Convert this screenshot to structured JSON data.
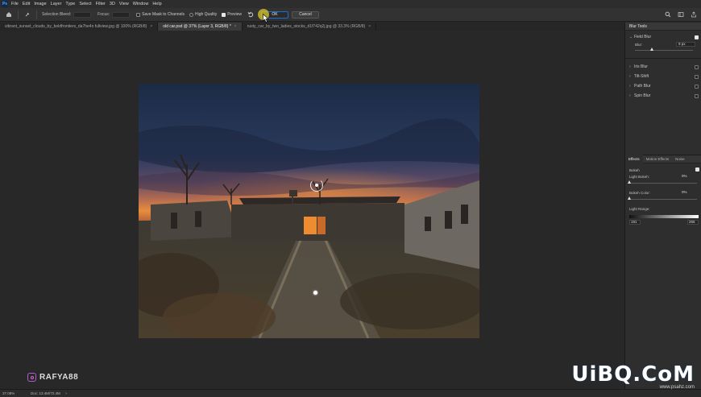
{
  "app": {
    "logo": "Ps",
    "menu": [
      "File",
      "Edit",
      "Image",
      "Layer",
      "Type",
      "Select",
      "Filter",
      "3D",
      "View",
      "Window",
      "Help"
    ]
  },
  "options": {
    "selection_bleed_label": "Selection Bleed:",
    "focus_label": "Focus:",
    "save_mask_label": "Save Mask to Channels",
    "high_quality_label": "High Quality",
    "preview_label": "Preview",
    "preview_checked": true,
    "ok_label": "OK",
    "cancel_label": "Cancel"
  },
  "tabs": [
    {
      "label": "vibrant_sunset_clouds_by_boldfrontiers_da7he4n fullview.jpg @ 100% (RGB/8)",
      "active": false
    },
    {
      "label": "old car.psd @ 37% (Layer 3, RGB/8) *",
      "active": true
    },
    {
      "label": "rusty_car_by_two_ladies_stocks_d1f742q2j.jpg @ 33.3% (RGB/8)",
      "active": false
    }
  ],
  "blur_tools": {
    "header": "Blur Tools",
    "items": [
      {
        "label": "Field Blur",
        "expanded": true,
        "checked": true
      },
      {
        "label": "Iris Blur",
        "expanded": false,
        "checked": false
      },
      {
        "label": "Tilt-Shift",
        "expanded": false,
        "checked": false
      },
      {
        "label": "Path Blur",
        "expanded": false,
        "checked": false
      },
      {
        "label": "Spin Blur",
        "expanded": false,
        "checked": false
      }
    ],
    "blur_label": "Blur:",
    "blur_value": "9 px",
    "blur_fraction": 0.3
  },
  "effects_panel": {
    "tabs": [
      "Effects",
      "Motion Effects",
      "Noise"
    ],
    "bokeh_label": "Bokeh",
    "light_bokeh_label": "Light Bokeh:",
    "light_bokeh_value": "0%",
    "bokeh_color_label": "Bokeh Color:",
    "bokeh_color_value": "0%",
    "light_range_label": "Light Range:",
    "range_low": "191",
    "range_high": "255"
  },
  "status": {
    "zoom": "37.08%",
    "doc": "Doc: 13.4M/72.4M",
    "arrow": ">"
  },
  "watermark": {
    "handle": "RAFYA88",
    "site_big": "UiBQ.CoM",
    "site_small": "www.psahz.com"
  },
  "colors": {
    "accent": "#1c6dd0",
    "cursor_highlight": "#dcc828"
  }
}
